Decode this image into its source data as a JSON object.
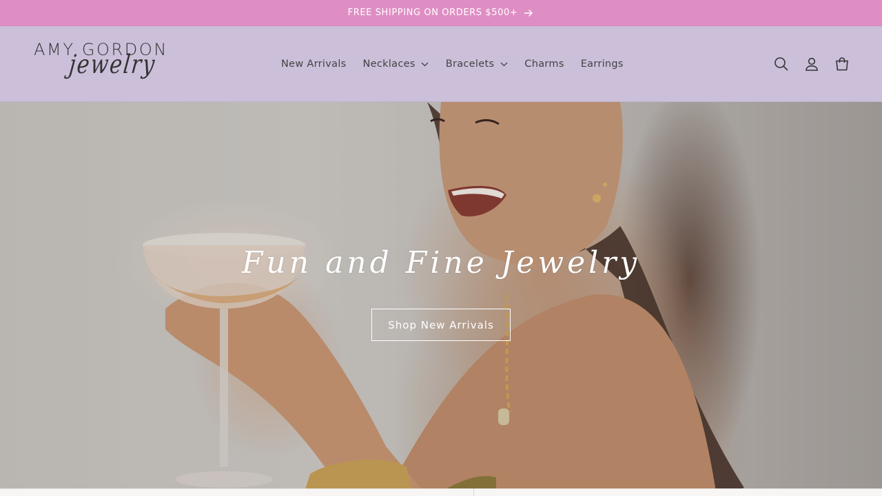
{
  "announcement": {
    "text": "FREE SHIPPING ON ORDERS $500+",
    "icon": "arrow-right-icon",
    "background": "#df8ec3",
    "color": "#ffffff"
  },
  "header": {
    "background": "#cbbfd9",
    "logo": {
      "line1": "AMY GORDON",
      "line2": "jewelry"
    },
    "nav": [
      {
        "label": "New Arrivals",
        "dropdown": false
      },
      {
        "label": "Necklaces",
        "dropdown": true
      },
      {
        "label": "Bracelets",
        "dropdown": true
      },
      {
        "label": "Charms",
        "dropdown": false
      },
      {
        "label": "Earrings",
        "dropdown": false
      }
    ],
    "icons": [
      "search-icon",
      "account-icon",
      "cart-icon"
    ]
  },
  "hero": {
    "title": "Fun and Fine Jewelry",
    "cta_label": "Shop New Arrivals"
  }
}
